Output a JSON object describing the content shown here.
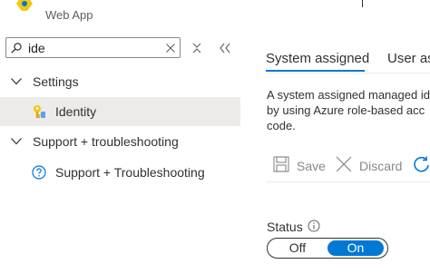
{
  "header": {
    "subtitle": "Web App",
    "icon": "web-app-icon"
  },
  "search": {
    "value": "ide",
    "icon": "search-icon",
    "clear_icon": "close-icon"
  },
  "nav": {
    "groups": [
      {
        "label": "Settings",
        "expanded": true,
        "items": [
          {
            "label": "Identity",
            "icon": "key-icon",
            "selected": true
          }
        ]
      },
      {
        "label": "Support + troubleshooting",
        "expanded": true,
        "items": [
          {
            "label": "Support + Troubleshooting",
            "icon": "help-circle-icon",
            "selected": false
          }
        ]
      }
    ]
  },
  "tabs": [
    {
      "label": "System assigned",
      "active": true
    },
    {
      "label": "User as",
      "active": false
    }
  ],
  "description": {
    "line1": "A system assigned managed id",
    "line2": "by using Azure role-based acc",
    "line3": "code."
  },
  "toolbar": {
    "save_label": "Save",
    "discard_label": "Discard"
  },
  "status": {
    "label": "Status",
    "off_label": "Off",
    "on_label": "On",
    "value": "On"
  },
  "colors": {
    "accent": "#0078d4",
    "selected_bg": "#edebe9",
    "disabled_text": "#8a8886"
  }
}
